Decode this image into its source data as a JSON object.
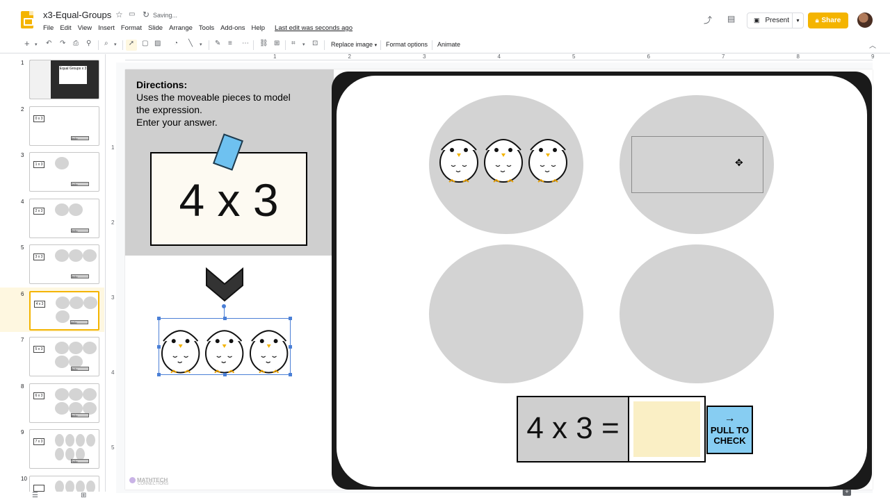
{
  "app": {
    "doc_title": "x3-Equal-Groups",
    "saving_status": "Saving...",
    "menu": [
      "File",
      "Edit",
      "View",
      "Insert",
      "Format",
      "Slide",
      "Arrange",
      "Tools",
      "Add-ons",
      "Help"
    ],
    "last_edit": "Last edit was seconds ago",
    "present_label": "Present",
    "share_label": "Share"
  },
  "toolbar": {
    "replace_image": "Replace image",
    "format_options": "Format options",
    "animate": "Animate"
  },
  "ruler": [
    "1",
    "2",
    "3",
    "4",
    "5",
    "6",
    "7",
    "8",
    "9"
  ],
  "vruler": [
    "1",
    "2",
    "3",
    "4",
    "5"
  ],
  "filmstrip": [
    {
      "num": "1",
      "kind": "title",
      "label": "Equal Groups",
      "expr": "x 3"
    },
    {
      "num": "2",
      "kind": "circles",
      "circles": 0,
      "expr": "0 x 3",
      "ans": "0x3="
    },
    {
      "num": "3",
      "kind": "circles",
      "circles": 1,
      "expr": "1 x 3",
      "ans": "1x3="
    },
    {
      "num": "4",
      "kind": "circles",
      "circles": 2,
      "expr": "2 x 3",
      "ans": "2x3="
    },
    {
      "num": "5",
      "kind": "circles",
      "circles": 3,
      "expr": "3 x 3",
      "ans": "3x3="
    },
    {
      "num": "6",
      "kind": "circles",
      "circles": 4,
      "expr": "4 x 3",
      "ans": "4x3=",
      "selected": true
    },
    {
      "num": "7",
      "kind": "circles",
      "circles": 5,
      "expr": "5 x 3",
      "ans": "5x3="
    },
    {
      "num": "8",
      "kind": "circles",
      "circles": 6,
      "expr": "6 x 3",
      "ans": "6x3="
    },
    {
      "num": "9",
      "kind": "circles",
      "circles": 7,
      "expr": "7 x 3",
      "ans": "7x3="
    },
    {
      "num": "10",
      "kind": "circles",
      "circles": 8,
      "expr": "",
      "ans": ""
    }
  ],
  "slide": {
    "directions_title": "Directions:",
    "directions_lines": [
      "Uses the moveable pieces to model",
      "the expression.",
      "Enter your answer."
    ],
    "expression": "4 x 3",
    "answer_label": "4 x 3 =",
    "check_line1": "PULL TO",
    "check_line2": "CHECK",
    "check_arrow": "→",
    "brand": "MATHTECH",
    "brand_sub": "CONNECTIONS"
  },
  "colors": {
    "accent": "#f4b400",
    "panel_gray": "#cfcfcf",
    "circle_gray": "#d3d3d3",
    "answer_fill": "#faefc5",
    "check_blue": "#87cdf2",
    "selection": "#4a7fd6"
  },
  "icons": [
    "docs-slides-logo",
    "star-icon",
    "folder-move-icon",
    "sync-icon",
    "trend-icon",
    "comment-icon",
    "present-icon",
    "lock-icon",
    "plus-icon",
    "undo-icon",
    "redo-icon",
    "print-icon",
    "paint-format-icon",
    "zoom-icon",
    "select-cursor-icon",
    "textbox-icon",
    "image-icon",
    "shape-icon",
    "line-icon",
    "pen-icon",
    "border-weight-icon",
    "border-dash-icon",
    "link-icon",
    "comment-add-icon",
    "crop-icon",
    "mask-icon",
    "collapse-icon",
    "move-cursor-icon",
    "chevron-down-icon"
  ]
}
